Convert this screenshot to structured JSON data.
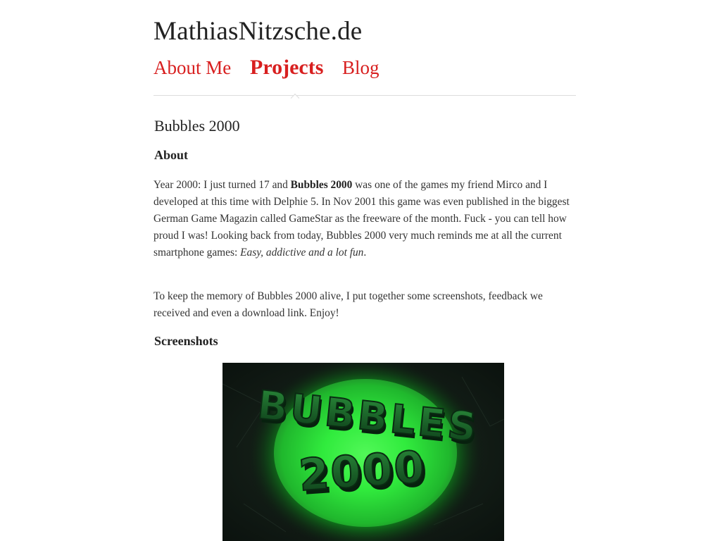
{
  "header": {
    "site_title": "MathiasNitzsche.de"
  },
  "nav": {
    "items": [
      {
        "label": "About Me",
        "active": false
      },
      {
        "label": "Projects",
        "active": true
      },
      {
        "label": "Blog",
        "active": false
      }
    ]
  },
  "article": {
    "title": "Bubbles 2000",
    "about_heading": "About",
    "para1": {
      "before_bold": "Year 2000: I just turned 17 and ",
      "bold": "Bubbles 2000",
      "after_bold": " was one of the games my friend Mirco and I developed at this time with Delphie 5. In Nov 2001 this game was even published in the biggest German Game Magazin called GameStar as the freeware of the month. Fuck - you can tell how proud I was! Looking back from today, Bubbles 2000 very much reminds me at all the current smartphone games: ",
      "italic": "Easy, addictive and a lot fun",
      "end": "."
    },
    "para2": "To keep the memory of Bubbles 2000 alive, I put together some screenshots, feedback we received and even a download link. Enjoy!",
    "screenshots_heading": "Screenshots",
    "screenshot": {
      "logo_line1": "BUBBLES",
      "logo_line2": "2000"
    }
  },
  "colors": {
    "link": "#d81f1f",
    "text": "#222222",
    "rule": "#dddddd",
    "glow": "#3dff4a"
  }
}
